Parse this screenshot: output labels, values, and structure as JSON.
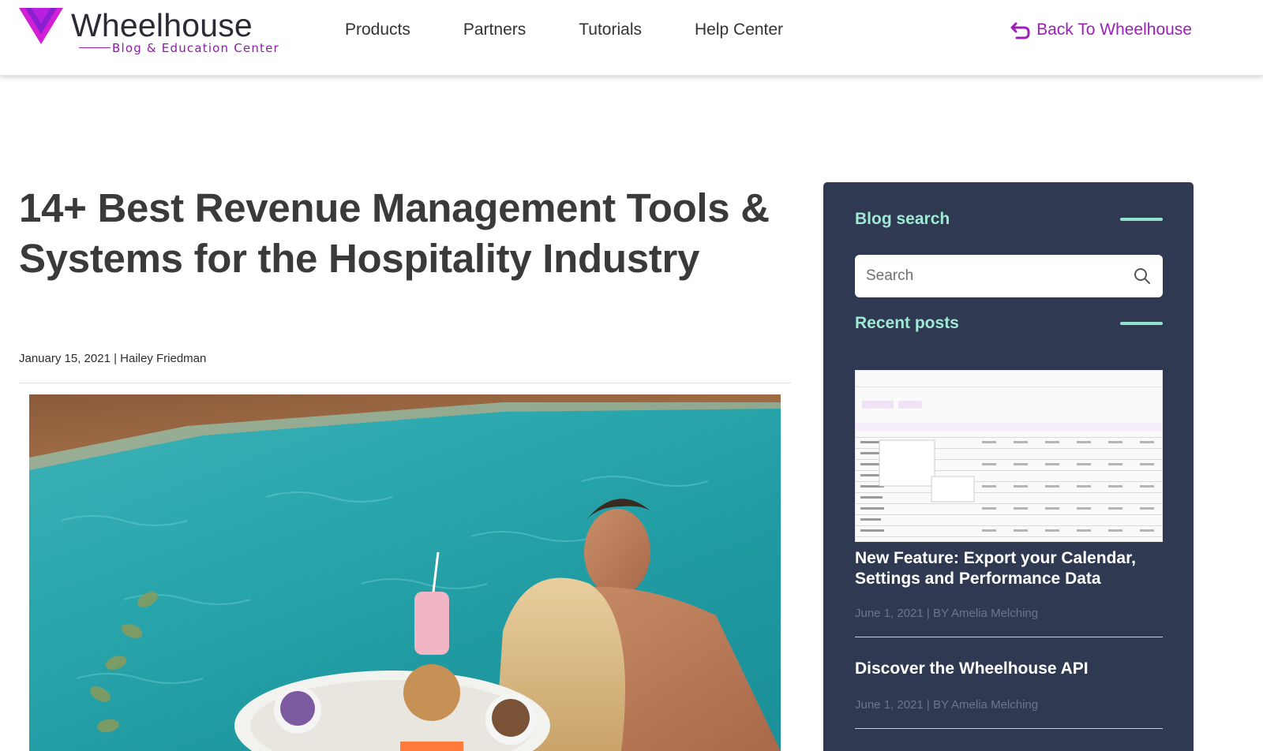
{
  "header": {
    "logo_word": "Wheelhouse",
    "logo_sub": "Blog & Education Center",
    "nav": [
      "Products",
      "Partners",
      "Tutorials",
      "Help Center"
    ],
    "back_label": "Back To Wheelhouse",
    "accent_color": "#9b1fb7"
  },
  "article": {
    "title": "14+ Best Revenue Management Tools & Systems for the Hospitality Industry",
    "meta": "January 15, 2021 | Hailey Friedman"
  },
  "sidebar": {
    "search_title": "Blog search",
    "search_placeholder": "Search",
    "recent_title": "Recent posts",
    "heading_color": "#9fe8d3",
    "background_color": "#2f3a52",
    "posts": [
      {
        "title": "New Feature: Export your Calendar, Settings and Performance Data",
        "meta": "June 1, 2021 | BY Amelia Melching"
      },
      {
        "title": "Discover the Wheelhouse API",
        "meta": "June 1, 2021 | BY Amelia Melching"
      }
    ]
  }
}
